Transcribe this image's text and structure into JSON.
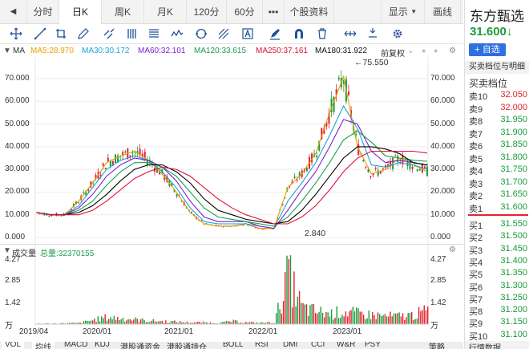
{
  "tabs": [
    {
      "label": "分时"
    },
    {
      "label": "日K"
    },
    {
      "label": "周K"
    },
    {
      "label": "月K"
    },
    {
      "label": "120分"
    },
    {
      "label": "60分"
    },
    {
      "label": "•••"
    },
    {
      "label": "个股资料"
    }
  ],
  "topbar_right": {
    "display": "显示",
    "draw": "画线"
  },
  "ma_legend": {
    "ma": "MA",
    "ma5": "MA5:28.970",
    "ma30": "MA30:30.172",
    "ma60": "MA60:32.101",
    "ma120": "MA120:33.615",
    "ma250": "MA250:37.161",
    "ma180": "MA180:31.922",
    "adjust": "前复权"
  },
  "colors": {
    "ma5": "#e8a000",
    "ma30": "#1aa3d6",
    "ma60": "#7a1fd0",
    "ma120": "#1b9e4b",
    "ma250": "#e0103a",
    "ma180": "#000000",
    "up": "#e0242e",
    "down": "#1a9b3a"
  },
  "price_axis": [
    "70.000",
    "60.000",
    "50.000",
    "40.000",
    "30.000",
    "20.000",
    "10.000",
    "0.000"
  ],
  "annotations": {
    "high": "←75.550",
    "low": "2.840"
  },
  "volume": {
    "label": "成交量",
    "total": "总量:32370155",
    "axis": [
      "4.27",
      "2.85",
      "1.42"
    ],
    "unit_marker": "万",
    "unit_bottom": "万"
  },
  "date_axis": [
    "2019/04",
    "2020/01",
    "2021/01",
    "2022/01",
    "2023/01"
  ],
  "bottom_tabs": [
    "VOL",
    "均线",
    "MACD",
    "KDJ",
    "港股通资金",
    "港股通持仓",
    "BOLL",
    "RSI",
    "DMI",
    "CCI",
    "W&R",
    "PSY",
    "策略"
  ],
  "stock": {
    "name": "东方甄选",
    "price": "31.600",
    "arrow": "↓"
  },
  "buttons": {
    "add": "+ 自选"
  },
  "orderbook": {
    "title": "买卖档位与明细",
    "subtitle": "买卖档位",
    "asks": [
      {
        "label": "卖10",
        "price": "32.050"
      },
      {
        "label": "卖9",
        "price": "32.000"
      },
      {
        "label": "卖8",
        "price": "31.950"
      },
      {
        "label": "卖7",
        "price": "31.900"
      },
      {
        "label": "卖6",
        "price": "31.850"
      },
      {
        "label": "卖5",
        "price": "31.800"
      },
      {
        "label": "卖4",
        "price": "31.750"
      },
      {
        "label": "卖3",
        "price": "31.700"
      },
      {
        "label": "卖2",
        "price": "31.650"
      },
      {
        "label": "卖1",
        "price": "31.600"
      }
    ],
    "bids": [
      {
        "label": "买1",
        "price": "31.550"
      },
      {
        "label": "买2",
        "price": "31.500"
      },
      {
        "label": "买3",
        "price": "31.450"
      },
      {
        "label": "买4",
        "price": "31.400"
      },
      {
        "label": "买5",
        "price": "31.350"
      },
      {
        "label": "买6",
        "price": "31.300"
      },
      {
        "label": "买7",
        "price": "31.250"
      },
      {
        "label": "买8",
        "price": "31.200"
      },
      {
        "label": "买9",
        "price": "31.150"
      },
      {
        "label": "买10",
        "price": "31.100"
      }
    ],
    "footer": "行情数据"
  },
  "icons": [
    "crosshair-icon",
    "line-icon",
    "rect-icon",
    "pen-icon",
    "channel-icon",
    "bars-icon",
    "wave-icon",
    "circle-icon",
    "fork-icon",
    "text-icon",
    "marker-icon",
    "magnet-icon",
    "trash-icon",
    "move-icon",
    "fit-icon",
    "settings-icon"
  ],
  "chart_data": {
    "type": "line",
    "title": "",
    "x_ticks": [
      "2019/04",
      "2020/01",
      "2021/01",
      "2022/01",
      "2023/01"
    ],
    "ylim": [
      0,
      75
    ],
    "y_ticks": [
      0,
      10,
      20,
      30,
      40,
      50,
      60,
      70
    ],
    "series": [
      {
        "name": "MA5",
        "values": [
          11,
          10,
          10,
          16,
          24,
          33,
          36,
          38,
          34,
          28,
          20,
          11,
          6,
          5,
          5,
          6,
          4,
          4,
          22,
          28,
          37,
          55,
          71,
          40,
          28,
          30,
          35,
          32,
          29
        ]
      },
      {
        "name": "MA30",
        "values": [
          11,
          10,
          10,
          14,
          22,
          30,
          34,
          36,
          34,
          29,
          22,
          13,
          7,
          6,
          6,
          6,
          5,
          4,
          16,
          24,
          33,
          45,
          58,
          48,
          32,
          31,
          33,
          32,
          30
        ]
      },
      {
        "name": "MA60",
        "values": [
          11,
          10,
          10,
          13,
          19,
          27,
          32,
          35,
          34,
          31,
          25,
          16,
          9,
          7,
          7,
          7,
          5,
          4,
          12,
          21,
          29,
          40,
          52,
          50,
          38,
          33,
          34,
          33,
          32
        ]
      },
      {
        "name": "MA120",
        "values": [
          11,
          10,
          10,
          12,
          16,
          23,
          29,
          33,
          33,
          31,
          27,
          20,
          13,
          9,
          8,
          7,
          6,
          5,
          9,
          16,
          24,
          33,
          43,
          47,
          42,
          36,
          35,
          34,
          33.6
        ]
      },
      {
        "name": "MA180",
        "values": [
          11,
          10,
          10,
          11,
          14,
          19,
          25,
          30,
          32,
          32,
          29,
          24,
          17,
          12,
          10,
          8,
          7,
          6,
          7,
          12,
          19,
          27,
          35,
          40,
          40,
          39,
          37,
          33,
          31.9
        ]
      },
      {
        "name": "MA250",
        "values": [
          11,
          10,
          10,
          10,
          12,
          16,
          21,
          26,
          29,
          31,
          30,
          27,
          22,
          17,
          13,
          10,
          8,
          6,
          6,
          9,
          14,
          21,
          29,
          35,
          38,
          38,
          38,
          38,
          37.2
        ]
      }
    ],
    "annotations": [
      {
        "text": "←75.550",
        "value": 75.55
      },
      {
        "text": "2.840",
        "value": 2.84
      }
    ],
    "volume_axis": [
      1.42,
      2.85,
      4.27
    ],
    "volume_values": [
      0.05,
      0.05,
      0.08,
      0.1,
      0.35,
      0.6,
      0.5,
      0.4,
      0.3,
      0.25,
      0.2,
      0.15,
      0.15,
      0.1,
      0.25,
      0.15,
      0.12,
      0.15,
      4.27,
      1.4,
      1.1,
      0.9,
      1.1,
      0.9,
      0.8,
      0.7,
      0.7,
      0.8,
      1.2
    ]
  }
}
